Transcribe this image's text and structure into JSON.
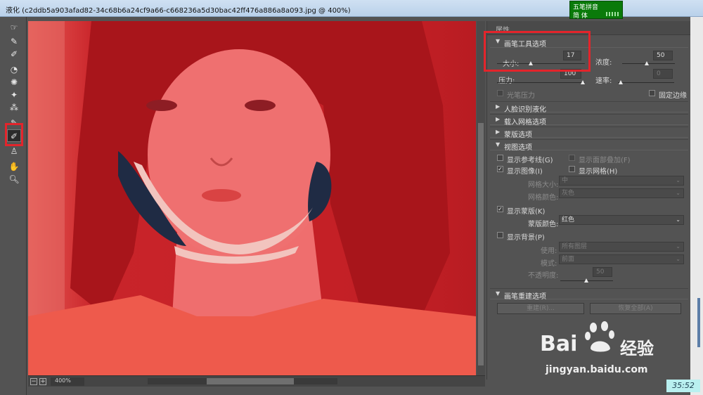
{
  "window": {
    "title": "液化 (c2ddb5a903afad82-34c68b6a24cf9a66-c668236a5d30bac42ff476a886a8a093.jpg @ 400%)"
  },
  "ime": {
    "row1": "五笔拼音",
    "row2": "简 体"
  },
  "toolbar": {
    "tools": [
      {
        "name": "forward-warp-tool-icon",
        "glyph": "☞"
      },
      {
        "name": "reconstruct-tool-icon",
        "glyph": "✎"
      },
      {
        "name": "smooth-tool-icon",
        "glyph": "✐"
      },
      {
        "name": "twirl-tool-icon",
        "glyph": "◔"
      },
      {
        "name": "pucker-tool-icon",
        "glyph": "✺"
      },
      {
        "name": "bloat-tool-icon",
        "glyph": "✦"
      },
      {
        "name": "push-left-tool-icon",
        "glyph": "⁂"
      },
      {
        "name": "freeze-mask-tool-icon",
        "glyph": "✎"
      },
      {
        "name": "thaw-mask-tool-icon",
        "glyph": "✐"
      },
      {
        "name": "face-tool-icon",
        "glyph": "♙"
      },
      {
        "name": "hand-tool-icon",
        "glyph": "✋"
      },
      {
        "name": "zoom-tool-icon",
        "glyph": "🔍︎"
      }
    ]
  },
  "canvas": {
    "zoom_value": "400%"
  },
  "panel": {
    "title": "属性",
    "brush_options": {
      "header": "画笔工具选项",
      "size_label": "大小:",
      "size_value": "17",
      "density_label": "浓度:",
      "density_value": "50",
      "pressure_label": "压力:",
      "pressure_value": "100",
      "rate_label": "速率:",
      "rate_value": "0",
      "stylus_pressure_label": "光笔压力",
      "pin_edges_label": "固定边缘"
    },
    "face_aware": {
      "header": "人脸识别液化"
    },
    "load_mesh": {
      "header": "载入网格选项"
    },
    "mask_options": {
      "header": "蒙版选项"
    },
    "view_options": {
      "header": "视图选项",
      "show_guides": "显示参考线(G)",
      "show_face_overlay": "显示面部叠加(F)",
      "show_image": "显示图像(I)",
      "show_mesh": "显示网格(H)",
      "mesh_size_label": "网格大小:",
      "mesh_size_value": "中",
      "mesh_color_label": "网格颜色:",
      "mesh_color_value": "灰色",
      "show_mask": "显示蒙版(K)",
      "mask_color_label": "蒙版颜色:",
      "mask_color_value": "红色",
      "show_backdrop": "显示背景(P)",
      "use_label": "使用:",
      "use_value": "所有图层",
      "mode_label": "模式:",
      "mode_value": "前面",
      "opacity_label": "不透明度:",
      "opacity_value": "50"
    },
    "brush_reconstruct": {
      "header": "画笔重建选项",
      "reconstruct_button": "重建(R)...",
      "restore_all_button": "恢复全部(A)"
    }
  },
  "watermark": {
    "brand_a": "Bai",
    "brand_b": "经验",
    "url": "jingyan.baidu.com"
  },
  "clock": {
    "time": "35:52"
  },
  "colors": {
    "mask_red": "#d32a2a",
    "highlight_red": "#e3242b",
    "panel_bg": "#535353"
  }
}
